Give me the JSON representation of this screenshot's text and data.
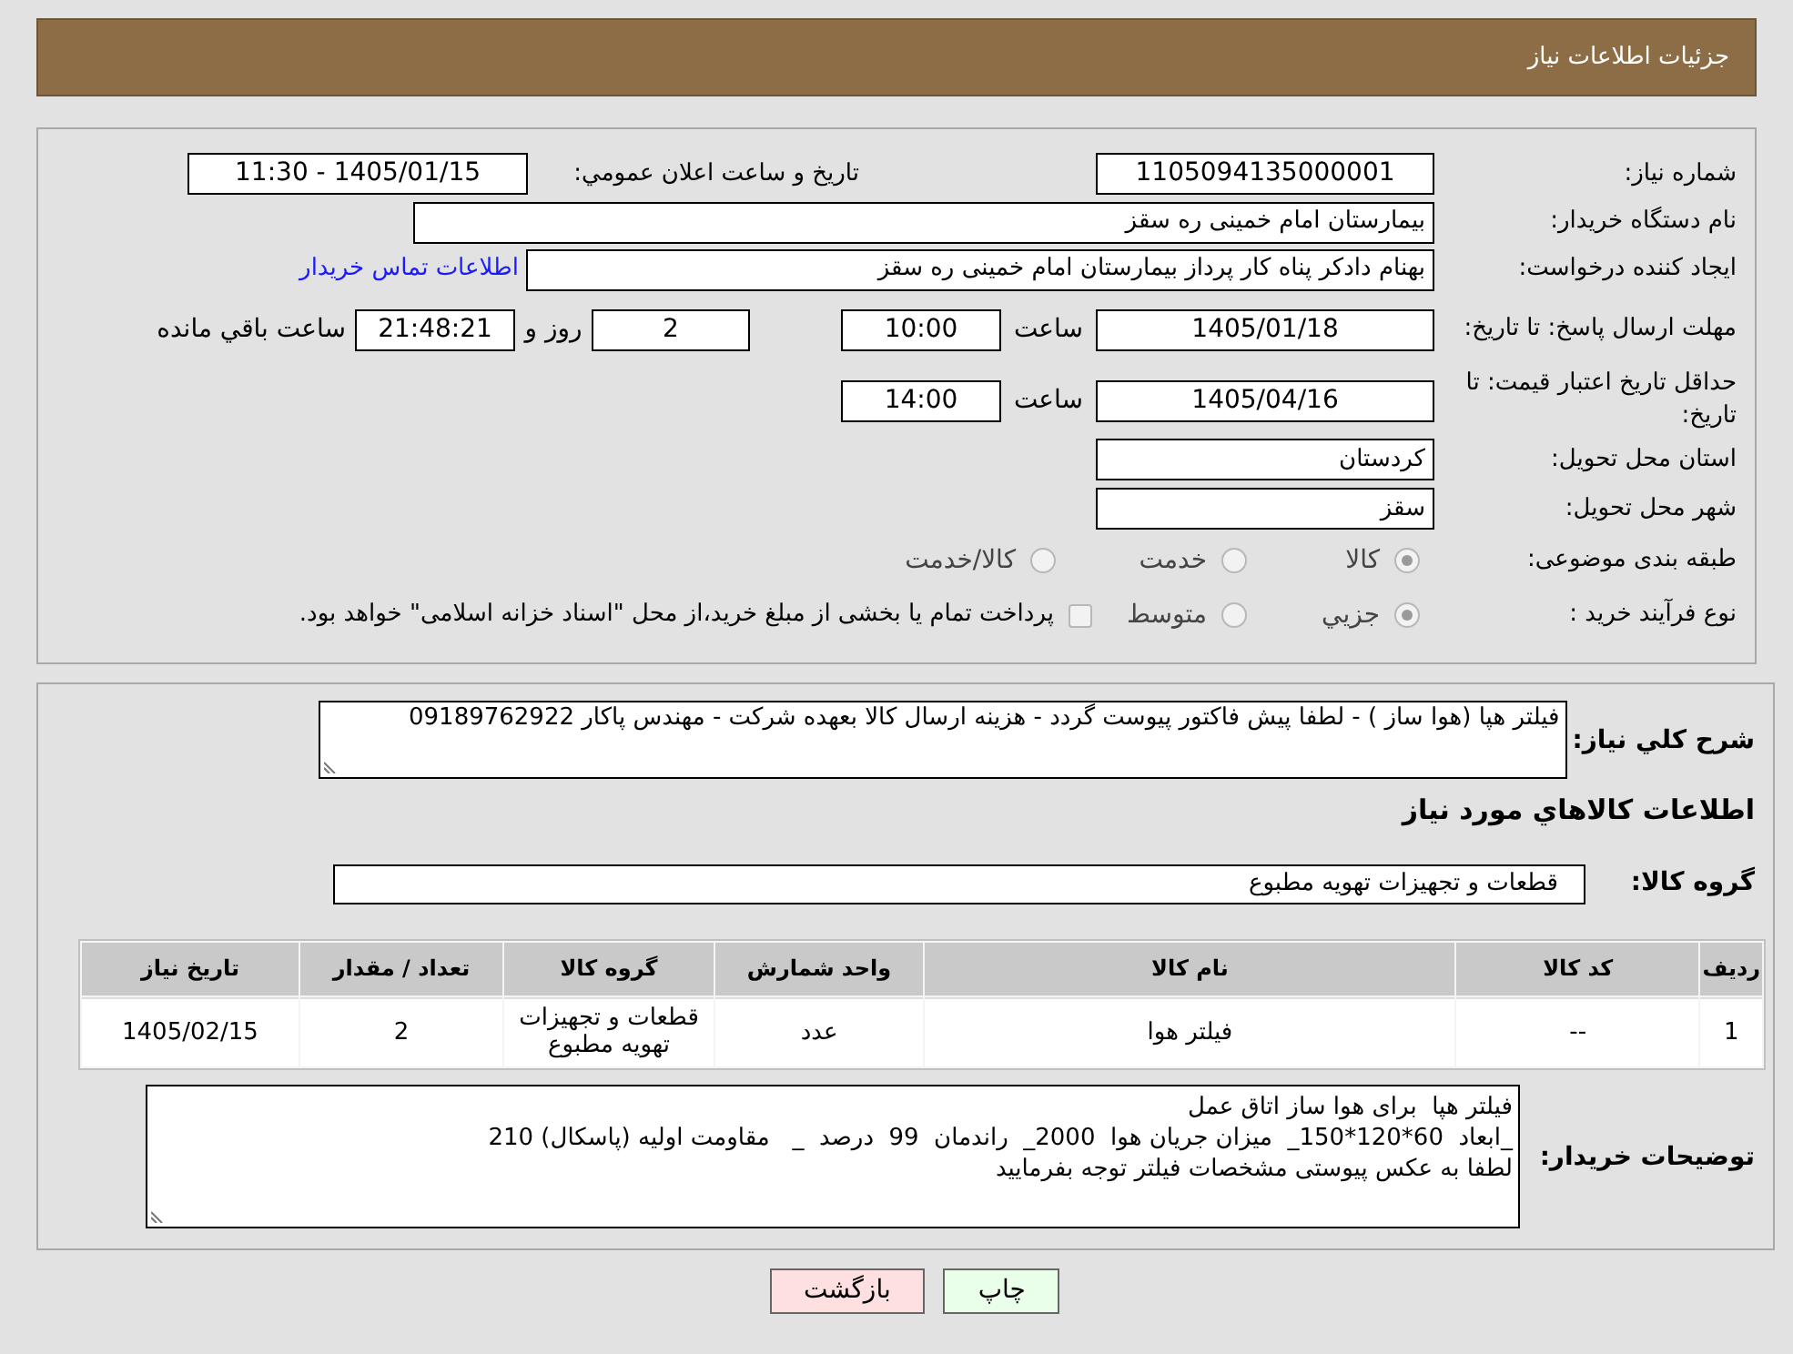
{
  "header": {
    "title": "جزئیات اطلاعات نیاز"
  },
  "need_number": {
    "label": "شماره نیاز:",
    "value": "1105094135000001"
  },
  "announcement": {
    "label": "تاریخ و ساعت اعلان عمومي:",
    "value": "1405/01/15 - 11:30"
  },
  "buyer_org": {
    "label": "نام دستگاه خریدار:",
    "value": "بیمارستان امام خمینی  ره  سقز"
  },
  "requester": {
    "label": "ایجاد کننده درخواست:",
    "value": "بهنام دادکر پناه کار پرداز بیمارستان امام خمینی  ره  سقز",
    "link": "اطلاعات تماس خریدار"
  },
  "reply_deadline": {
    "label": "مهلت ارسال پاسخ: تا تاریخ:",
    "date": "1405/01/18",
    "time_label": "ساعت",
    "time": "10:00",
    "days": "2",
    "days_label": "روز و",
    "remaining": "21:48:21",
    "remaining_label": "ساعت باقي مانده"
  },
  "price_validity": {
    "label": "حداقل تاریخ اعتبار قیمت: تا تاریخ:",
    "date": "1405/04/16",
    "time_label": "ساعت",
    "time": "14:00"
  },
  "province": {
    "label": "استان محل تحویل:",
    "value": "کردستان"
  },
  "city": {
    "label": "شهر محل تحویل:",
    "value": "سقز"
  },
  "category": {
    "label": "طبقه بندی موضوعی:",
    "options": [
      {
        "label": "کالا",
        "selected": true
      },
      {
        "label": "خدمت",
        "selected": false
      },
      {
        "label": "کالا/خدمت",
        "selected": false
      }
    ]
  },
  "purchase_type": {
    "label": "نوع فرآیند خرید :",
    "options": [
      {
        "label": "جزیي",
        "selected": true
      },
      {
        "label": "متوسط",
        "selected": false
      }
    ],
    "treasury": {
      "label": "پرداخت تمام یا بخشی از مبلغ خرید،از محل \"اسناد خزانه اسلامی\" خواهد بود.",
      "checked": false
    }
  },
  "description": {
    "label": "شرح کلي نیاز:",
    "value": "فیلتر هپا (هوا ساز ) - لطفا پیش فاکتور پیوست گردد -  هزینه ارسال کالا بعهده شرکت - مهندس پاکار 09189762922"
  },
  "items_heading": "اطلاعات کالاهاي مورد نیاز",
  "goods_group": {
    "label": "گروه کالا:",
    "value": "قطعات و تجهیزات تهویه مطبوع"
  },
  "table": {
    "columns": [
      "ردیف",
      "کد کالا",
      "نام کالا",
      "واحد شمارش",
      "گروه کالا",
      "تعداد / مقدار",
      "تاریخ نیاز"
    ],
    "rows": [
      [
        "1",
        "--",
        "فیلتر هوا",
        "عدد",
        "قطعات و تجهیزات تهویه مطبوع",
        "2",
        "1405/02/15"
      ]
    ]
  },
  "buyer_notes": {
    "label": "توضیحات خریدار:",
    "lines": [
      "فیلتر هپا  برای هوا ساز اتاق عمل",
      "_ابعاد  60*120*150_  میزان جریان هوا  2000_  راندمان  99  درصد  _   مقاومت اولیه (پاسکال) 210",
      "لطفا به عکس پیوستی مشخصات فیلتر توجه بفرمایید"
    ]
  },
  "buttons": [
    {
      "kind": "print",
      "label": "چاپ"
    },
    {
      "kind": "back",
      "label": "بازگشت"
    }
  ]
}
